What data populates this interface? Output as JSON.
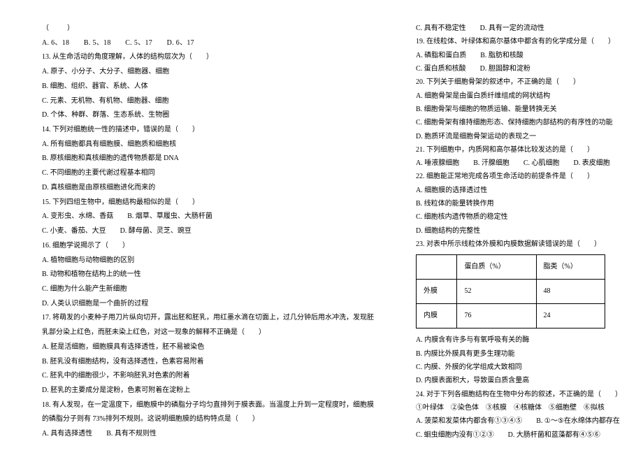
{
  "left": {
    "lblank": "（　　）",
    "q12opts": "A. 6、18　　B. 5、18　　C. 5、17　　D. 6、17",
    "q13": "13. 从生命活动的角度理解，人体的结构层次为（　　）",
    "q13a": "A. 原子、小分子、大分子、细胞器、细胞",
    "q13b": "B. 细胞、组织、器官、系统、人体",
    "q13c": "C. 元素、无机物、有机物、细胞器、细胞",
    "q13d": "D. 个体、种群、群落、生态系统、生物圈",
    "q14": "14. 下列对细胞统一性的描述中，错误的是（　　）",
    "q14a": "A. 所有细胞都具有细胞膜、细胞质和细胞核",
    "q14b": "B. 原核细胞和真核细胞的遗传物质都是 DNA",
    "q14c": "C. 不同细胞的主要代谢过程基本相同",
    "q14d": "D. 真核细胞是由原核细胞进化而来的",
    "q15": "15. 下列四组生物中，细胞结构最相似的是（　　）",
    "q15a": "A. 变形虫、水绵、香菇　　B. 烟草、草履虫、大肠杆菌",
    "q15c": "C. 小麦、番茄、大豆　　D. 酵母菌、灵芝、豌豆",
    "q16": "16. 细胞学说揭示了（　　）",
    "q16a": "A. 植物细胞与动物细胞的区别",
    "q16b": "B. 动物和植物在结构上的统一性",
    "q16c": "C. 细胞为什么能产生新细胞",
    "q16d": "D. 人类认识细胞是一个曲折的过程",
    "q17": "17. 将萌发的小麦种子用刀片纵向切开，露出胚和胚乳，用红墨水滴在切面上，过几分钟后用水冲洗，发现胚",
    "q17_2": "乳部分染上红色，而胚未染上红色，对这一现象的解释不正确是（　　）",
    "q17a": "A. 胚是活细胞，细胞膜具有选择透性，胚不易被染色",
    "q17b": "B. 胚乳没有细胞结构，没有选择透性，色素容易附着",
    "q17c": "C. 胚乳中的细胞很少，不影响胚乳对色素的附着",
    "q17d": "D. 胚乳的主要成分是淀粉，色素可附着在淀粉上",
    "q18": "18. 有人发现，在一定温度下，细胞膜中的磷脂分子均匀直排列于膜表面。当温度上升到一定程度时，细胞膜",
    "q18_2": "的磷脂分子则有 73%排列不规则。这说明细胞膜的结构特点是（　　）",
    "q18ab": "A. 具有选择透性　　B. 具有不规则性"
  },
  "right": {
    "q18cd": "C. 具有不稳定性　　D. 具有一定的流动性",
    "q19": "19. 在线粒体、叶绿体和高尔基体中都含有的化学成分是（　　）",
    "q19a": "A. 磷脂和蛋白质　　B. 脂肪和核酸",
    "q19c": "C. 蛋白质和核酸　　D. 胆固醇和淀粉",
    "q20": "20. 下列关于细胞骨架的叙述中，不正确的是（　　）",
    "q20a": "A. 细胞骨架是由蛋白质纤维组成的网状结构",
    "q20b": "B. 细胞骨架与细胞的物质运输、能量转换无关",
    "q20c": "C. 细胞骨架有维持细胞形态、保持细胞内部结构的有序性的功能",
    "q20d": "D. 胞质环流是细胞骨架运动的表现之一",
    "q21": "21. 下列细胞中，内质网和高尔基体比较发达的是（　　）",
    "q21a": "A. 唾液腺细胞　　B. 汗腺细胞　　C. 心肌细胞　　D. 表皮细胞",
    "q22": "22. 细胞能正常地完成各项生命活动的前提条件是（　　）",
    "q22a": "A. 细胞膜的选择透过性",
    "q22b": "B. 线粒体的能量转换作用",
    "q22c": "C. 细胞核内遗传物质的稳定性",
    "q22d": "D. 细胞结构的完整性",
    "q23": "23. 对表中所示线粒体外膜和内膜数据解读错误的是（　　）",
    "table": {
      "h1": "",
      "h2": "蛋白质（%）",
      "h3": "脂类（%）",
      "r1c1": "外膜",
      "r1c2": "52",
      "r1c3": "48",
      "r2c1": "内膜",
      "r2c2": "76",
      "r2c3": "24"
    },
    "q23a": "A. 内膜含有许多与有氧呼吸有关的酶",
    "q23b": "B. 内膜比外膜具有更多生理功能",
    "q23c": "C. 内膜、外膜的化学组成大致相同",
    "q23d": "D. 内膜表面积大，导致蛋白质含量高",
    "q24": "24. 对于下列各细胞结构在生物中分布的叙述，不正确的是（　　）",
    "q24opts": "①叶绿体　②染色体　③核膜　④核糖体　⑤细胞壁　⑥拟核",
    "q24a": "A. 菠菜和发菜体内都含有①③④⑤　　B. ①～⑤在水绵体内都存在",
    "q24c": "C. 蛔虫细胞内没有①②③　　D. 大肠杆菌和蓝藻都有④⑤⑥"
  }
}
